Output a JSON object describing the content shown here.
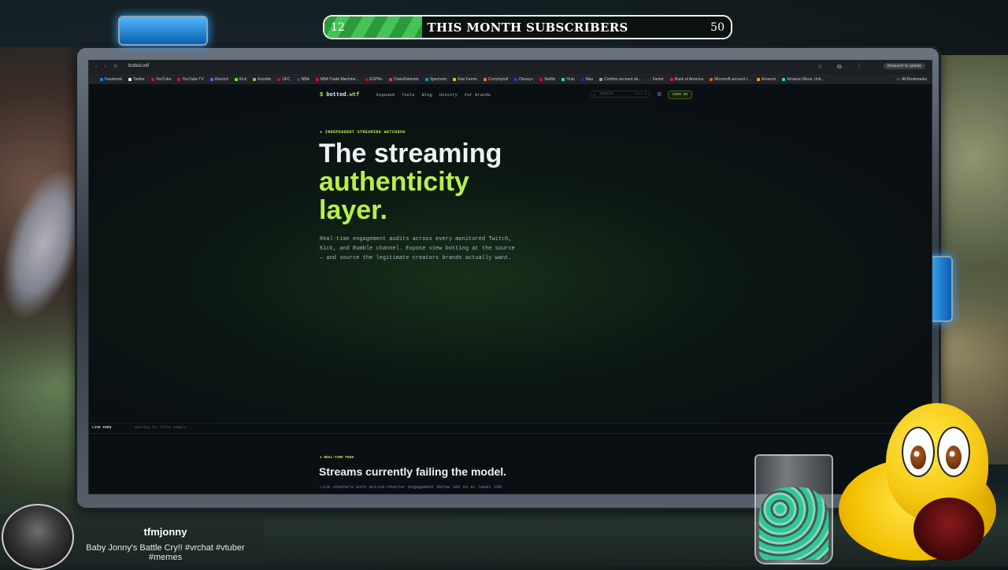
{
  "subscriber_goal": {
    "current": "12",
    "goal": "50",
    "title": "THIS MONTH SUBSCRIBERS",
    "progress_fraction": 0.24,
    "fill_color": "#3cb44b"
  },
  "browser": {
    "url": "botted.wtf",
    "relaunch_label": "Relaunch to update",
    "bookmarks": [
      {
        "label": "Facebook",
        "color": "#1877f2"
      },
      {
        "label": "Twitter",
        "color": "#e7e9ea"
      },
      {
        "label": "YouTube",
        "color": "#ff0000"
      },
      {
        "label": "YouTube TV",
        "color": "#ff0000"
      },
      {
        "label": "Discord",
        "color": "#5865f2"
      },
      {
        "label": "Kick",
        "color": "#53fc18"
      },
      {
        "label": "Rumble",
        "color": "#85c742"
      },
      {
        "label": "UFC",
        "color": "#d20a0a"
      },
      {
        "label": "NBA",
        "color": "#1d428a"
      },
      {
        "label": "NBA Trade Machine...",
        "color": "#c8102e"
      },
      {
        "label": "ESPN+",
        "color": "#cc0000"
      },
      {
        "label": "DownDetector",
        "color": "#e0393e"
      },
      {
        "label": "Spectrum",
        "color": "#0099d8"
      },
      {
        "label": "Kiwi Farms",
        "color": "#e8c300"
      },
      {
        "label": "Crunchyroll",
        "color": "#f47521"
      },
      {
        "label": "Disney+",
        "color": "#113ccf"
      },
      {
        "label": "Netflix",
        "color": "#e50914"
      },
      {
        "label": "Hulu",
        "color": "#1ce783"
      },
      {
        "label": "Max",
        "color": "#002be7"
      },
      {
        "label": "Confirm account de...",
        "color": "#9aa0a6"
      },
      {
        "label": "Factor",
        "color": "#2b2b2b"
      },
      {
        "label": "Bank of America",
        "color": "#e31837"
      },
      {
        "label": "Microsoft account l...",
        "color": "#f25022"
      },
      {
        "label": "Amazon",
        "color": "#ff9900"
      },
      {
        "label": "Amazon Music Unli...",
        "color": "#25d1da"
      }
    ],
    "all_bookmarks_label": "All Bookmarks"
  },
  "site": {
    "logo": {
      "dollar": "$",
      "name": "botted",
      "tld": ".wtf"
    },
    "nav": [
      "Exposed",
      "Tools",
      "Blog",
      "History",
      "For Brands"
    ],
    "search_placeholder": "Search",
    "search_shortcut": "ctrl K",
    "sign_in_label": "SIGN IN",
    "accent_color": "#b6f04a",
    "hero": {
      "eyebrow": "● INDEPENDENT STREAMING WATCHDOG",
      "title_line1": "The streaming",
      "title_accent": "authenticity",
      "title_line3": "layer.",
      "lede": "Real-time engagement audits across every monitored Twitch, Kick, and Rumble channel. Expose view botting at the source — and source the legitimate creators brands actually want."
    },
    "live_feed": {
      "label": "LIVE FEED",
      "separator": "·",
      "status": "waiting for first sample..."
    },
    "section": {
      "eyebrow": "● REAL-TIME FEED",
      "title": "Streams currently failing the model.",
      "subtitle": "Live channels with active-chatter engagement below 10% on at least 100"
    }
  },
  "stream_info": {
    "username": "tfmjonny",
    "title": "Baby Jonny's Battle Cry!! #vrchat #vtuber #memes"
  }
}
